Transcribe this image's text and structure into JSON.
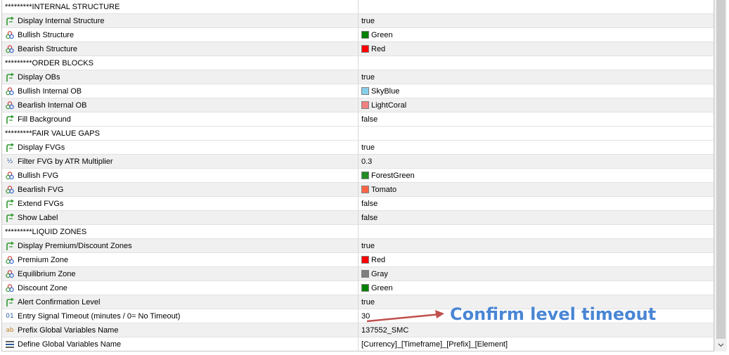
{
  "rows": [
    {
      "name": "*********INTERNAL STRUCTURE",
      "value": "",
      "icon": "none",
      "kind": "header"
    },
    {
      "name": "Display Internal Structure",
      "value": "true",
      "icon": "bool-arrow-icon"
    },
    {
      "name": "Bullish Structure",
      "value": "Green",
      "icon": "color-palette-icon",
      "swatch": "#008000"
    },
    {
      "name": "Bearish Structure",
      "value": "Red",
      "icon": "color-palette-icon",
      "swatch": "#ff0000"
    },
    {
      "name": "*********ORDER BLOCKS",
      "value": "",
      "icon": "none",
      "kind": "header"
    },
    {
      "name": "Display OBs",
      "value": "true",
      "icon": "bool-arrow-icon"
    },
    {
      "name": "Bullish Internal OB",
      "value": "SkyBlue",
      "icon": "color-palette-icon",
      "swatch": "#87ceeb"
    },
    {
      "name": "Bearlish Internal OB",
      "value": "LightCoral",
      "icon": "color-palette-icon",
      "swatch": "#f08080"
    },
    {
      "name": "Fill Background",
      "value": "false",
      "icon": "bool-arrow-icon"
    },
    {
      "name": "*********FAIR VALUE GAPS",
      "value": "",
      "icon": "none",
      "kind": "header"
    },
    {
      "name": "Display FVGs",
      "value": "true",
      "icon": "bool-arrow-icon"
    },
    {
      "name": "Filter FVG by ATR Multiplier",
      "value": "0.3",
      "icon": "fraction-icon"
    },
    {
      "name": "Bullish FVG",
      "value": "ForestGreen",
      "icon": "color-palette-icon",
      "swatch": "#228b22"
    },
    {
      "name": "Bearlish FVG",
      "value": "Tomato",
      "icon": "color-palette-icon",
      "swatch": "#ff6347"
    },
    {
      "name": "Extend FVGs",
      "value": "false",
      "icon": "bool-arrow-icon"
    },
    {
      "name": "Show Label",
      "value": "false",
      "icon": "bool-arrow-icon"
    },
    {
      "name": "*********LIQUID ZONES",
      "value": "",
      "icon": "none",
      "kind": "header"
    },
    {
      "name": "Display Premium/Discount Zones",
      "value": "true",
      "icon": "bool-arrow-icon"
    },
    {
      "name": "Premium Zone",
      "value": "Red",
      "icon": "color-palette-icon",
      "swatch": "#ff0000"
    },
    {
      "name": "Equilibrium Zone",
      "value": "Gray",
      "icon": "color-palette-icon",
      "swatch": "#808080"
    },
    {
      "name": "Discount Zone",
      "value": "Green",
      "icon": "color-palette-icon",
      "swatch": "#008000"
    },
    {
      "name": "Alert Confirmation Level",
      "value": "true",
      "icon": "bool-arrow-icon"
    },
    {
      "name": "Entry Signal Timeout (minutes / 0= No Timeout)",
      "value": "30",
      "icon": "integer-icon"
    },
    {
      "name": "Prefix Global Variables Name",
      "value": "137552_SMC",
      "icon": "string-icon"
    },
    {
      "name": "Define Global Variables Name",
      "value": "[Currency]_[Timeframe]_[Prefix]_[Element]",
      "icon": "enum-list-icon"
    }
  ],
  "icons": {
    "integer_glyph": "01",
    "string_glyph": "ab",
    "fraction_glyph": "½"
  },
  "annotation": {
    "text": "Confirm level timeout",
    "text_color": "#4a86d4",
    "arrow_color": "#c0504d"
  },
  "colors": {
    "row_alt": "#f0f0f0",
    "bool_icon": "#2e9a2e"
  }
}
